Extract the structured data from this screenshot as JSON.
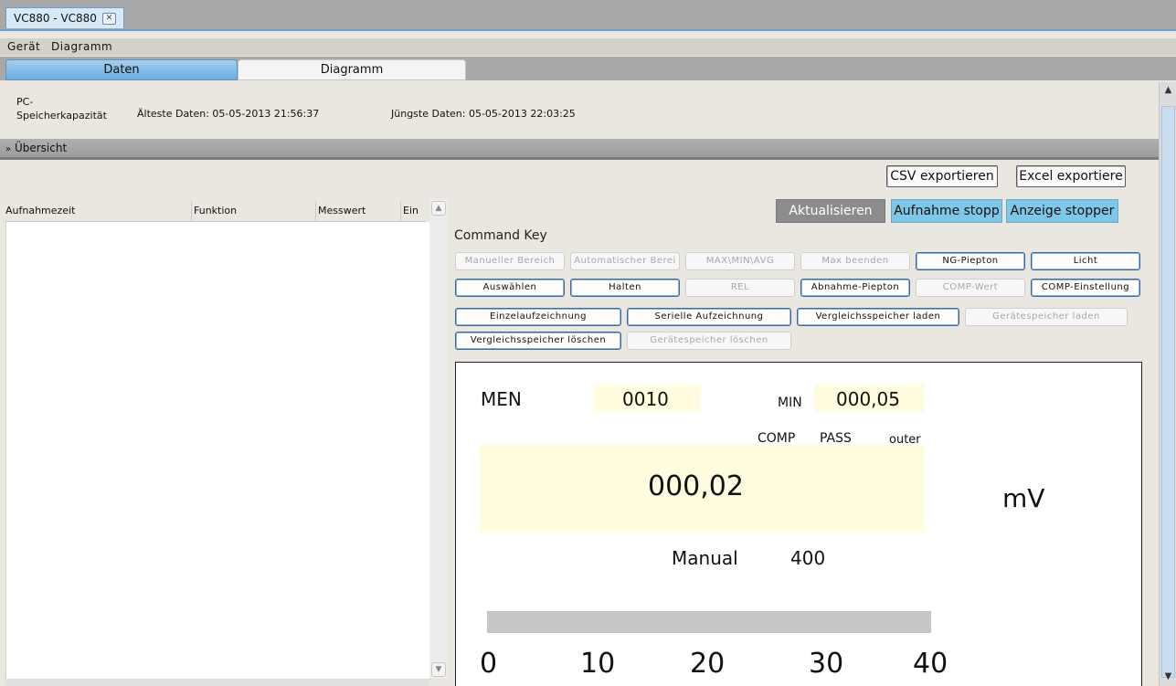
{
  "window": {
    "tab_title": "VC880 - VC880",
    "tab_close": "✕"
  },
  "menu": {
    "items": [
      "Gerät",
      "Diagramm"
    ]
  },
  "view_tabs": [
    "Daten",
    "Diagramm"
  ],
  "info": {
    "pc_label": "PC-\nSpeicherkapazität",
    "pc_line1": "PC-",
    "pc_line2": "Speicherkapazität",
    "oldest": "Älteste Daten: 05-05-2013 21:56:37",
    "newest": "Jüngste Daten: 05-05-2013 22:03:25"
  },
  "overview": {
    "label": "Übersicht",
    "icon": "double-chevron-down-icon"
  },
  "table": {
    "columns": [
      "Aufnahmezeit",
      "Funktion",
      "Messwert",
      "Ein"
    ],
    "rows": []
  },
  "export": {
    "csv": "CSV exportieren",
    "excel": "Excel exportiere"
  },
  "actions": {
    "refresh": "Aktualisieren",
    "record_stop": "Aufnahme stopp",
    "display_stop": "Anzeige stopper"
  },
  "command_key": {
    "title": "Command Key",
    "row1": [
      {
        "label": "Manueller Bereich",
        "enabled": false
      },
      {
        "label": "Automatischer Berei",
        "enabled": false
      },
      {
        "label": "MAX\\MIN\\AVG",
        "enabled": false
      },
      {
        "label": "Max beenden",
        "enabled": false
      },
      {
        "label": "NG-Piepton",
        "enabled": true
      },
      {
        "label": "Licht",
        "enabled": true
      }
    ],
    "row2": [
      {
        "label": "Auswählen",
        "enabled": true
      },
      {
        "label": "Halten",
        "enabled": true
      },
      {
        "label": "REL",
        "enabled": false
      },
      {
        "label": "Abnahme-Piepton",
        "enabled": true
      },
      {
        "label": "COMP-Wert",
        "enabled": false
      },
      {
        "label": "COMP-Einstellung",
        "enabled": true
      }
    ],
    "row3": [
      {
        "label": "Einzelaufzeichnung",
        "enabled": true
      },
      {
        "label": "Serielle Aufzeichnung",
        "enabled": true
      },
      {
        "label": "Vergleichsspeicher laden",
        "enabled": true
      },
      {
        "label": "Gerätespeicher laden",
        "enabled": false
      }
    ],
    "row4": [
      {
        "label": "Vergleichsspeicher löschen",
        "enabled": true
      },
      {
        "label": "Gerätespeicher löschen",
        "enabled": false
      }
    ]
  },
  "display": {
    "men_label": "MEN",
    "men_value": "0010",
    "min_label": "MIN",
    "min_value": "000,05",
    "comp_label": "COMP",
    "pass_label": "PASS",
    "outer_label": "outer",
    "main_value": "000,02",
    "unit": "mV",
    "range_mode": "Manual",
    "range_value": "400",
    "bar_level": 0.0,
    "scale": [
      "0",
      "10",
      "20",
      "30",
      "40"
    ]
  },
  "colors": {
    "accent_blue": "#7fc7e6",
    "tab_blue": "#6aaee0",
    "display_yellow": "#fffce0",
    "gray_button": "#8c8c8c"
  }
}
